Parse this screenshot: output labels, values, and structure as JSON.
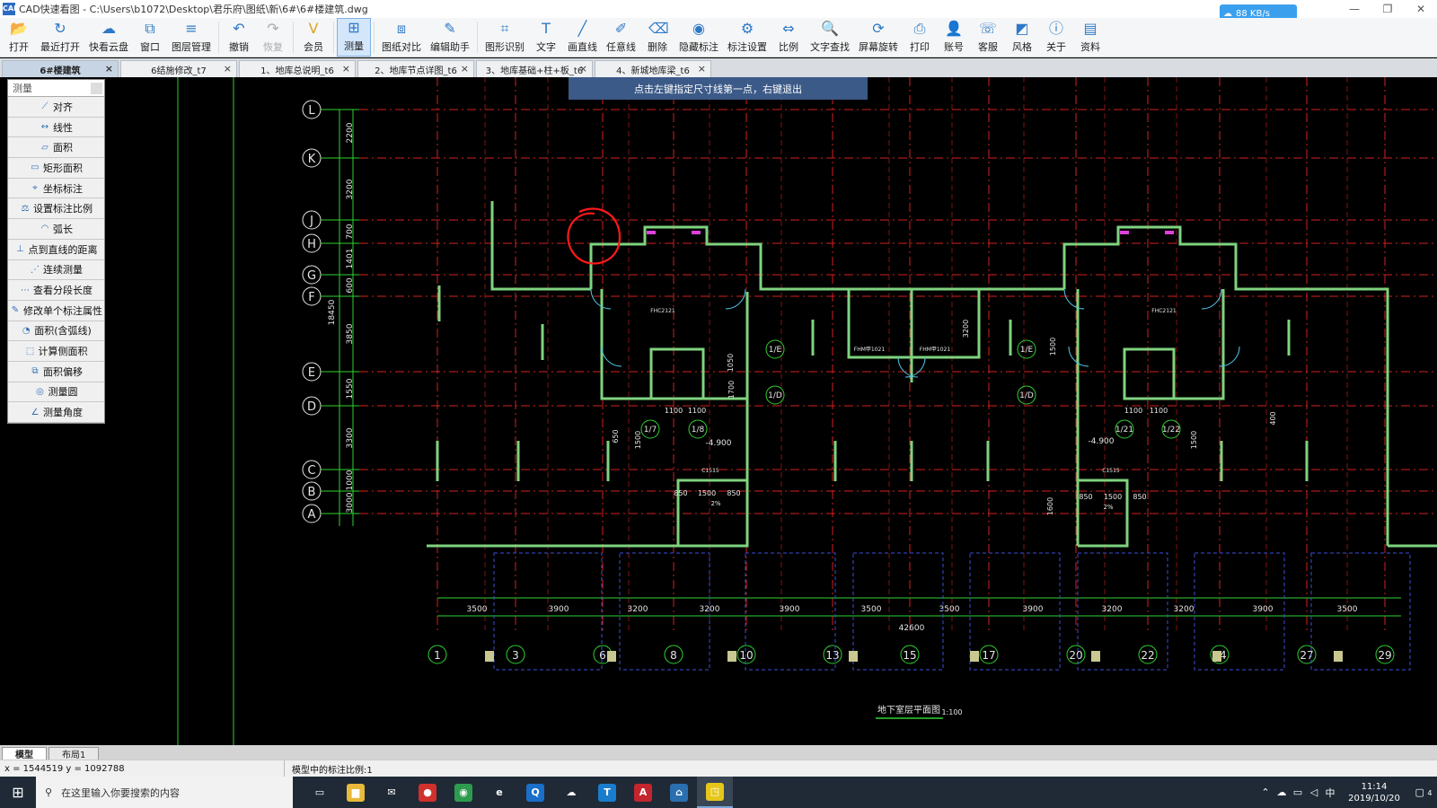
{
  "window": {
    "app_icon": "CAD",
    "title": "CAD快速看图 - C:\\Users\\b1072\\Desktop\\君乐府\\图纸\\新\\6#\\6#楼建筑.dwg",
    "speed_badge": "88 KB/s",
    "minimize": "—",
    "restore": "❐",
    "close": "✕"
  },
  "toolbar": [
    {
      "label": "打开",
      "icon": "folder-open-icon",
      "glyph": "📂"
    },
    {
      "label": "最近打开",
      "icon": "history-icon",
      "glyph": "↻"
    },
    {
      "label": "快看云盘",
      "icon": "cloud-icon",
      "glyph": "☁"
    },
    {
      "label": "窗口",
      "icon": "window-icon",
      "glyph": "⧉"
    },
    {
      "label": "图层管理",
      "icon": "layers-icon",
      "glyph": "≡"
    },
    {
      "label": "撤销",
      "icon": "undo-icon",
      "glyph": "↶"
    },
    {
      "label": "恢复",
      "icon": "redo-icon",
      "glyph": "↷"
    },
    {
      "label": "会员",
      "icon": "vip-icon",
      "glyph": "V"
    },
    {
      "label": "测量",
      "icon": "measure-icon",
      "glyph": "⊞"
    },
    {
      "label": "图纸对比",
      "icon": "compare-icon",
      "glyph": "⧈"
    },
    {
      "label": "编辑助手",
      "icon": "edit-assistant-icon",
      "glyph": "✎"
    },
    {
      "label": "图形识别",
      "icon": "shape-recognize-icon",
      "glyph": "⌗"
    },
    {
      "label": "文字",
      "icon": "text-icon",
      "glyph": "T"
    },
    {
      "label": "画直线",
      "icon": "line-icon",
      "glyph": "╱"
    },
    {
      "label": "任意线",
      "icon": "freehand-icon",
      "glyph": "✐"
    },
    {
      "label": "删除",
      "icon": "eraser-icon",
      "glyph": "⌫"
    },
    {
      "label": "隐藏标注",
      "icon": "hide-annotation-icon",
      "glyph": "◉"
    },
    {
      "label": "标注设置",
      "icon": "annotation-settings-icon",
      "glyph": "⚙"
    },
    {
      "label": "比例",
      "icon": "scale-icon",
      "glyph": "⇔"
    },
    {
      "label": "文字查找",
      "icon": "text-search-icon",
      "glyph": "🔍"
    },
    {
      "label": "屏幕旋转",
      "icon": "rotate-icon",
      "glyph": "⟳"
    },
    {
      "label": "打印",
      "icon": "print-icon",
      "glyph": "⎙"
    },
    {
      "label": "账号",
      "icon": "account-icon",
      "glyph": "👤"
    },
    {
      "label": "客服",
      "icon": "headset-icon",
      "glyph": "☏"
    },
    {
      "label": "风格",
      "icon": "style-icon",
      "glyph": "◩"
    },
    {
      "label": "关于",
      "icon": "info-icon",
      "glyph": "ⓘ"
    },
    {
      "label": "资料",
      "icon": "docs-icon",
      "glyph": "▤"
    }
  ],
  "tabs": [
    {
      "label": "6#楼建筑",
      "active": true
    },
    {
      "label": "6结施修改_t7",
      "active": false
    },
    {
      "label": "1、地库总说明_t6",
      "active": false
    },
    {
      "label": "2、地库节点详图_t6",
      "active": false
    },
    {
      "label": "3、地库基础+柱+板_t6",
      "active": false
    },
    {
      "label": "4、新城地库梁_t6",
      "active": false
    }
  ],
  "hint": "点击左键指定尺寸线第一点，右键退出",
  "measure_panel": {
    "title": "测量",
    "items": [
      {
        "label": "对齐",
        "icon": "align-dimension-icon",
        "glyph": "⟋"
      },
      {
        "label": "线性",
        "icon": "linear-dimension-icon",
        "glyph": "↔"
      },
      {
        "label": "面积",
        "icon": "area-icon",
        "glyph": "▱"
      },
      {
        "label": "矩形面积",
        "icon": "rect-area-icon",
        "glyph": "▭"
      },
      {
        "label": "坐标标注",
        "icon": "coordinate-icon",
        "glyph": "⌖"
      },
      {
        "label": "设置标注比例",
        "icon": "set-scale-icon",
        "glyph": "⚖"
      },
      {
        "label": "弧长",
        "icon": "arc-length-icon",
        "glyph": "◠"
      },
      {
        "label": "点到直线的距离",
        "icon": "point-line-distance-icon",
        "glyph": "⊥"
      },
      {
        "label": "连续测量",
        "icon": "continuous-measure-icon",
        "glyph": "⋰"
      },
      {
        "label": "查看分段长度",
        "icon": "segment-length-icon",
        "glyph": "⋯"
      },
      {
        "label": "修改单个标注属性",
        "icon": "edit-annotation-icon",
        "glyph": "✎"
      },
      {
        "label": "面积(含弧线)",
        "icon": "arc-area-icon",
        "glyph": "◔"
      },
      {
        "label": "计算侧面积",
        "icon": "side-area-icon",
        "glyph": "⬚"
      },
      {
        "label": "面积偏移",
        "icon": "area-offset-icon",
        "glyph": "⧉"
      },
      {
        "label": "测量圆",
        "icon": "circle-measure-icon",
        "glyph": "◎"
      },
      {
        "label": "测量角度",
        "icon": "angle-icon",
        "glyph": "∠"
      }
    ]
  },
  "drawing": {
    "row_axes": [
      "L",
      "K",
      "J",
      "H",
      "G",
      "F",
      "E",
      "D",
      "C",
      "B",
      "A"
    ],
    "col_axes": [
      "1",
      "3",
      "6",
      "8",
      "10",
      "13",
      "15",
      "17",
      "20",
      "22",
      "24",
      "27",
      "29"
    ],
    "left_dims": [
      "2200",
      "3200",
      "700",
      "1401",
      "600",
      "3850",
      "1550",
      "3300",
      "1000",
      "3000"
    ],
    "left_total": "18450",
    "bottom_dims": [
      "3500",
      "3900",
      "3200",
      "3200",
      "3900",
      "3500",
      "3500",
      "3900",
      "3200",
      "3200",
      "3900",
      "3500"
    ],
    "bottom_total": "42600",
    "drawing_title": "地下室层平面图",
    "drawing_scale": "1:100",
    "labels": [
      "-4.900",
      "-4.900",
      "1100",
      "1100",
      "1100",
      "1100",
      "850",
      "1500",
      "850",
      "850",
      "1500",
      "850",
      "2%",
      "2%",
      "1/E",
      "1/D",
      "1/E",
      "1/D",
      "1/7",
      "1/8",
      "1/21",
      "1/22",
      "FHC2121",
      "FHC2121",
      "FHM甲1021",
      "FHM甲1021",
      "C1515",
      "C1515",
      "3200",
      "1500",
      "1600",
      "1050",
      "650",
      "400",
      "1700",
      "1500",
      "1500"
    ]
  },
  "layout_tabs": [
    {
      "label": "模型",
      "active": true
    },
    {
      "label": "布局1",
      "active": false
    }
  ],
  "status": {
    "coords": "x = 1544519  y = 1092788",
    "scale": "模型中的标注比例:1"
  },
  "taskbar": {
    "search_placeholder": "在这里输入你要搜索的内容",
    "apps": [
      {
        "name": "task-view-icon",
        "glyph": "▭",
        "color": "#1f2a36"
      },
      {
        "name": "file-explorer-icon",
        "glyph": "▆",
        "color": "#e8b93b"
      },
      {
        "name": "mail-icon",
        "glyph": "✉",
        "color": "#1f2a36"
      },
      {
        "name": "app-red-icon",
        "glyph": "●",
        "color": "#d0312d"
      },
      {
        "name": "chrome-icon",
        "glyph": "◉",
        "color": "#2e9b4f"
      },
      {
        "name": "edge-icon",
        "glyph": "e",
        "color": "#1f2a36"
      },
      {
        "name": "search-app-icon",
        "glyph": "Q",
        "color": "#1a6fc9"
      },
      {
        "name": "cloud-app-icon",
        "glyph": "☁",
        "color": "#1f2a36"
      },
      {
        "name": "text-app-icon",
        "glyph": "T",
        "color": "#1a7ccc"
      },
      {
        "name": "autocad-icon",
        "glyph": "A",
        "color": "#c4262e"
      },
      {
        "name": "app-blue-icon",
        "glyph": "⌂",
        "color": "#2a6fb0"
      },
      {
        "name": "cad-viewer-icon",
        "glyph": "◳",
        "color": "#e6c619"
      }
    ],
    "ime": "中",
    "time": "11:14",
    "date": "2019/10/20",
    "notification_count": "4"
  },
  "colors": {
    "axis_green": "#2fd22f",
    "grid_red": "#d42020",
    "wall_green": "#7fd37f",
    "text_white": "#e6e6e6",
    "annotation_red": "#ff1a1a",
    "hint_bg": "#3c5a88"
  }
}
